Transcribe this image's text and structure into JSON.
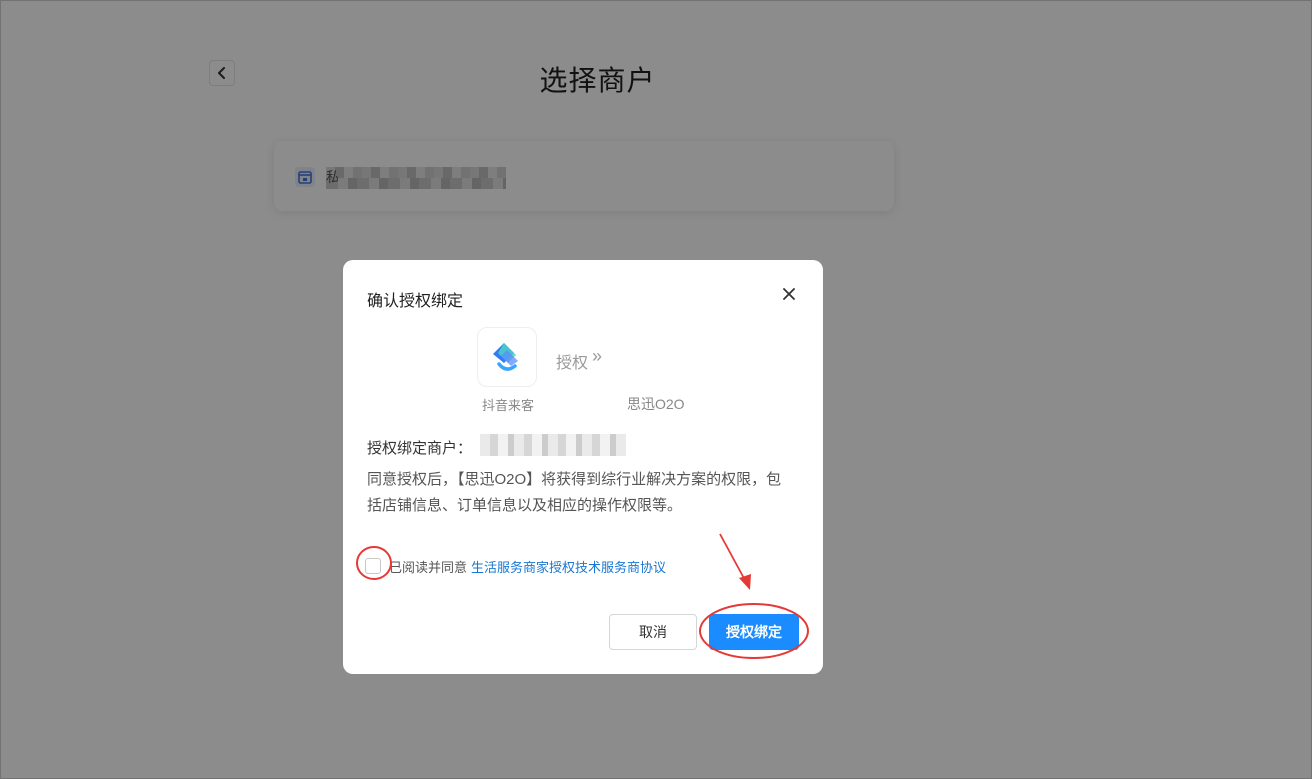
{
  "page": {
    "title": "选择商户",
    "back_icon": "chevron-left-icon",
    "merchant_card": {
      "icon": "store-icon",
      "name_redacted": "私"
    }
  },
  "modal": {
    "title": "确认授权绑定",
    "close_icon": "close-icon",
    "app": {
      "name": "抖音来客",
      "logo": "app-logo-icon"
    },
    "authorize_label": "授权",
    "authorize_arrow": "»",
    "partner_name": "思迅O2O",
    "bind_merchant_label": "授权绑定商户：",
    "bind_merchant_value": "",
    "description": "同意授权后，【思迅O2O】将获得到综行业解决方案的权限，包括店铺信息、订单信息以及相应的操作权限等。",
    "agree_text": "已阅读并同意",
    "agree_link": "生活服务商家授权技术服务商协议",
    "agree_checked": false,
    "cancel_label": "取消",
    "confirm_label": "授权绑定"
  },
  "colors": {
    "primary": "#1a8cff",
    "link": "#1976d2",
    "annotation": "#e53935",
    "overlay": "rgba(0,0,0,0.45)"
  }
}
